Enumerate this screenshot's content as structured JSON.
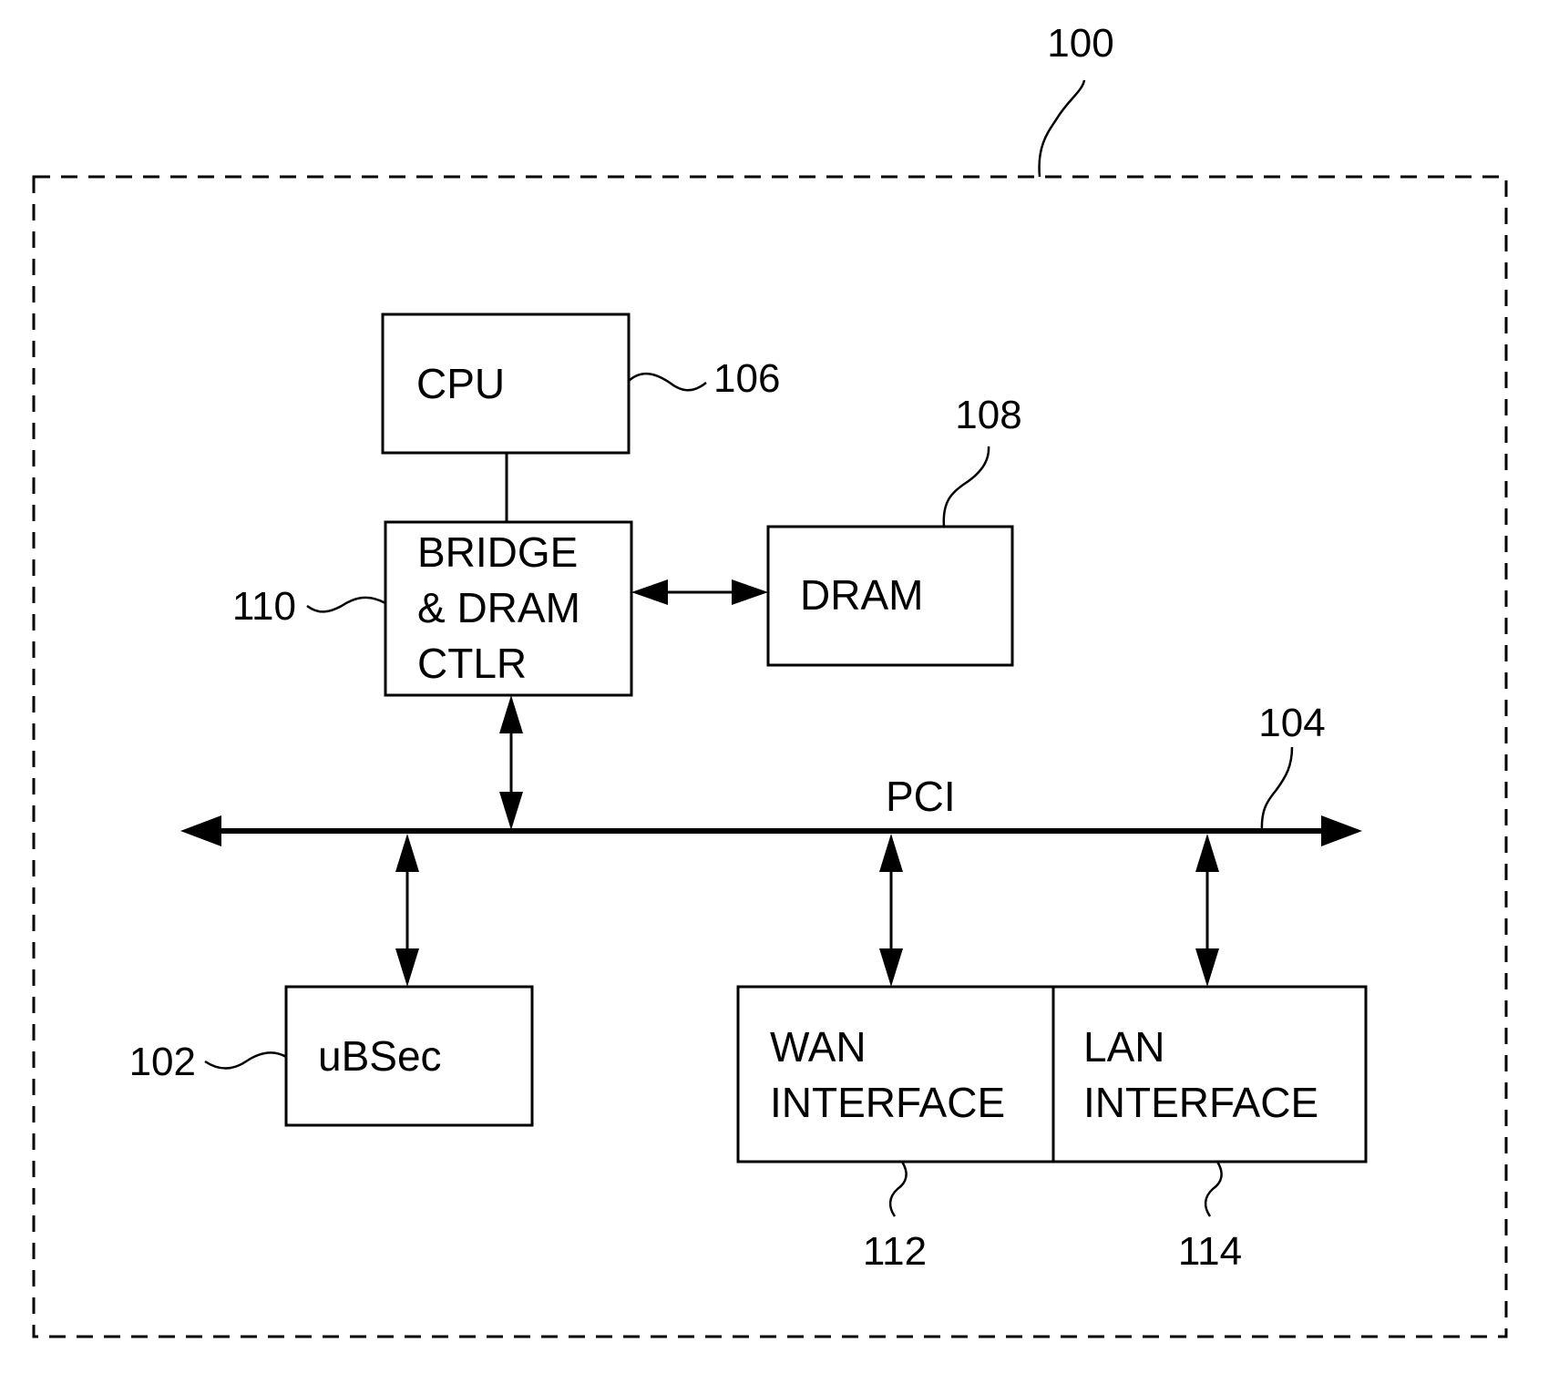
{
  "diagram": {
    "system_ref": "100",
    "bus": {
      "label": "PCI",
      "ref": "104"
    },
    "blocks": {
      "cpu": {
        "lines": [
          "CPU"
        ],
        "ref": "106"
      },
      "dram": {
        "lines": [
          "DRAM"
        ],
        "ref": "108"
      },
      "bridge": {
        "lines": [
          "BRIDGE",
          "& DRAM",
          "CTLR"
        ],
        "ref": "110"
      },
      "ubsec": {
        "lines": [
          "uBSec"
        ],
        "ref": "102"
      },
      "wan": {
        "lines": [
          "WAN",
          "INTERFACE"
        ],
        "ref": "112"
      },
      "lan": {
        "lines": [
          "LAN",
          "INTERFACE"
        ],
        "ref": "114"
      }
    },
    "connections": [
      {
        "from": "cpu",
        "to": "bridge",
        "type": "line"
      },
      {
        "from": "bridge",
        "to": "dram",
        "type": "bidirectional"
      },
      {
        "from": "bridge",
        "to": "pci",
        "type": "bidirectional"
      },
      {
        "from": "pci",
        "to": "ubsec",
        "type": "bidirectional"
      },
      {
        "from": "pci",
        "to": "wan",
        "type": "bidirectional"
      },
      {
        "from": "pci",
        "to": "lan",
        "type": "bidirectional"
      }
    ]
  }
}
